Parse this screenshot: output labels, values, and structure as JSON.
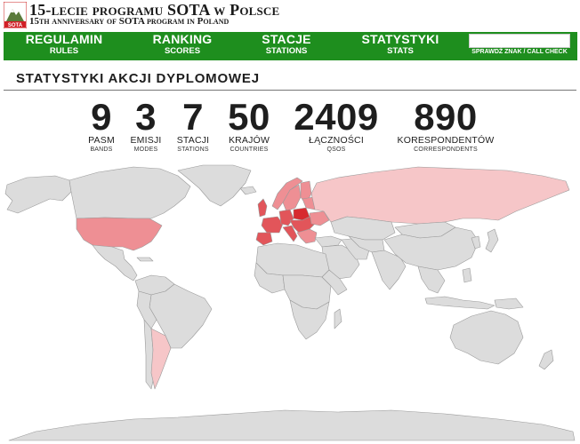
{
  "header": {
    "title": "15-lecie programu SOTA w Polsce",
    "subtitle": "15th anniversary of SOTA program in Poland",
    "logo_text": "SOTA"
  },
  "nav": {
    "items": [
      {
        "label": "REGULAMIN",
        "sub": "RULES"
      },
      {
        "label": "RANKING",
        "sub": "SCORES"
      },
      {
        "label": "STACJE",
        "sub": "STATIONS"
      },
      {
        "label": "STATYSTYKI",
        "sub": "STATS"
      }
    ],
    "search_value": "",
    "search_label": "SPRAWDŹ ZNAK / CALL CHECK"
  },
  "page_title": "STATYSTYKI AKCJI DYPLOMOWEJ",
  "stats": [
    {
      "value": "9",
      "label": "PASM",
      "sub": "BANDS"
    },
    {
      "value": "3",
      "label": "EMISJI",
      "sub": "MODES"
    },
    {
      "value": "7",
      "label": "STACJI",
      "sub": "STATIONS"
    },
    {
      "value": "50",
      "label": "KRAJÓW",
      "sub": "COUNTRIES"
    },
    {
      "value": "2409",
      "label": "ŁĄCZNOŚCI",
      "sub": "QSOS"
    },
    {
      "value": "890",
      "label": "KORESPONDENTÓW",
      "sub": "CORRESPONDENTS"
    }
  ],
  "colors": {
    "nav_green": "#1e8e1e",
    "land_default": "#dcdcdc",
    "land_border": "#9a9a9a",
    "heat_light": "#f6c6c8",
    "heat_mid": "#ee8f94",
    "heat_strong": "#e2555a",
    "heat_max": "#d72b30"
  }
}
